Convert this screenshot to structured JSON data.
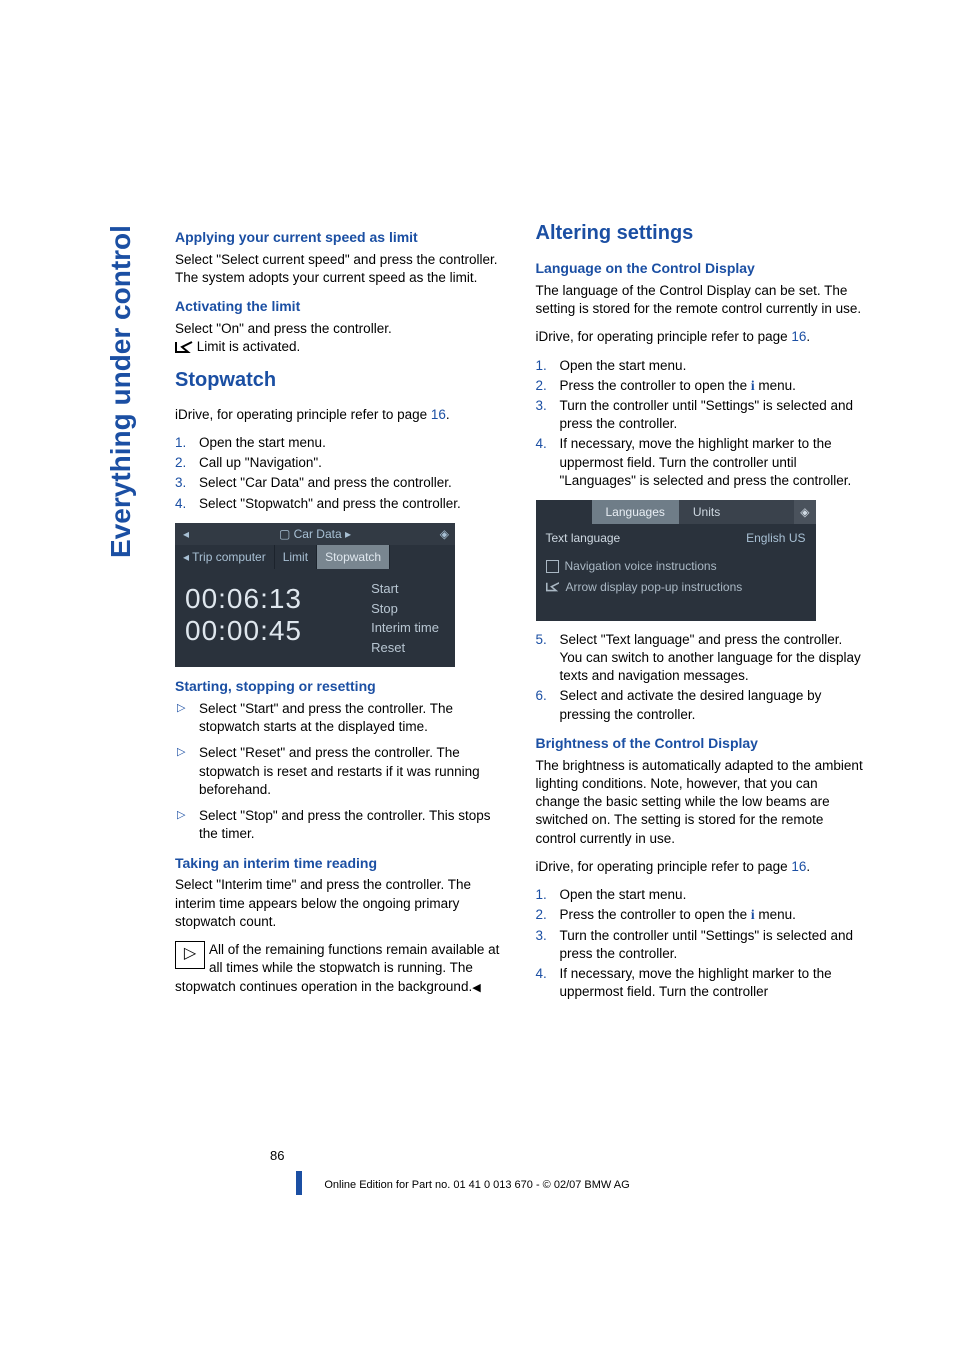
{
  "vertical_tab": "Everything under control",
  "left": {
    "h_apply": "Applying your current speed as limit",
    "p_apply": "Select \"Select current speed\" and press the controller. The system adopts your current speed as the limit.",
    "h_activate": "Activating the limit",
    "p_activate_1": "Select \"On\" and press the controller.",
    "p_activate_2": " Limit is activated.",
    "h_stopwatch": "Stopwatch",
    "p_idrive_sw_a": "iDrive, for operating principle refer to page ",
    "p_idrive_sw_b": "16",
    "p_idrive_sw_c": ".",
    "sw_steps": {
      "s1": "Open the start menu.",
      "s2": "Call up \"Navigation\".",
      "s3": "Select \"Car Data\" and press the controller.",
      "s4": "Select \"Stopwatch\" and press the controller."
    },
    "screen1": {
      "header": "Car Data",
      "arrow_left": "◂",
      "diamond": "◈",
      "tabs": {
        "t1_pre": "◂ ",
        "t1": "Trip computer",
        "t2": "Limit",
        "t3": "Stopwatch"
      },
      "time1": "00:06:13",
      "time2": "00:00:45",
      "actions": {
        "a1": "Start",
        "a2": "Stop",
        "a3": "Interim time",
        "a4": "Reset"
      }
    },
    "h_start": "Starting, stopping or resetting",
    "start_list": {
      "i1": "Select \"Start\" and press the controller. The stopwatch starts at the displayed time.",
      "i2": "Select \"Reset\" and press the controller. The stopwatch is reset and restarts if it was running beforehand.",
      "i3": "Select \"Stop\" and press the controller. This stops the timer."
    },
    "h_interim": "Taking an interim time reading",
    "p_interim": "Select \"Interim time\" and press the controller. The interim time appears below the ongoing primary stopwatch count.",
    "note_icon": "▷",
    "note": "All of the remaining functions remain available at all times while the stopwatch is running. The stopwatch continues operation in the background.",
    "end_tri": "◀"
  },
  "right": {
    "h_alter": "Altering settings",
    "h_lang": "Language on the Control Display",
    "p_lang": "The language of the Control Display can be set. The setting is stored for the remote control currently in use.",
    "p_idrive_a": "iDrive, for operating principle refer to page ",
    "p_idrive_b": "16",
    "p_idrive_c": ".",
    "lang_steps": {
      "s1": "Open the start menu.",
      "s2a": "Press the controller to open the ",
      "s2b": " menu.",
      "s3": "Turn the controller until \"Settings\" is selected and press the controller.",
      "s4": "If necessary, move the highlight marker to the uppermost field. Turn the controller until \"Languages\" is selected and press the controller."
    },
    "i_glyph": "i",
    "screen2": {
      "tab1": "Languages",
      "tab2": "Units",
      "diamond": "◈",
      "row_label": "Text language",
      "row_value": "English US",
      "item1": "Navigation voice instructions",
      "item2": "Arrow display pop-up instructions"
    },
    "lang_steps2": {
      "s5": "Select \"Text language\" and press the controller. You can switch to another language for the display texts and navigation messages.",
      "s6": "Select and activate the desired language by pressing the controller."
    },
    "h_bright": "Brightness of the Control Display",
    "p_bright": "The brightness is automatically adapted to the ambient lighting conditions. Note, however, that you can change the basic setting while the low beams are switched on. The setting is stored for the remote control currently in use.",
    "p_idrive2_a": "iDrive, for operating principle refer to page ",
    "p_idrive2_b": "16",
    "p_idrive2_c": ".",
    "bright_steps": {
      "s1": "Open the start menu.",
      "s2a": "Press the controller to open the ",
      "s2b": " menu.",
      "s3": "Turn the controller until \"Settings\" is selected and press the controller.",
      "s4": "If necessary, move the highlight marker to the uppermost field. Turn the controller"
    }
  },
  "footer": {
    "pagenum": "86",
    "line": "Online Edition for Part no. 01 41 0 013 670 - © 02/07 BMW AG"
  },
  "chart_data": {
    "type": "table",
    "title": "iDrive screenshots embedded in manual page",
    "screens": [
      {
        "name": "Car Data > Stopwatch",
        "tabs": [
          "Trip computer",
          "Limit",
          "Stopwatch"
        ],
        "active_tab": "Stopwatch",
        "displayed_times": [
          "00:06:13",
          "00:00:45"
        ],
        "actions": [
          "Start",
          "Stop",
          "Interim time",
          "Reset"
        ]
      },
      {
        "name": "Settings > Languages",
        "tabs": [
          "Languages",
          "Units"
        ],
        "active_tab": "Languages",
        "rows": [
          {
            "label": "Text language",
            "value": "English US"
          },
          {
            "label": "Navigation voice instructions",
            "value": "unchecked"
          },
          {
            "label": "Arrow display pop-up instructions",
            "value": "checked"
          }
        ]
      }
    ]
  }
}
